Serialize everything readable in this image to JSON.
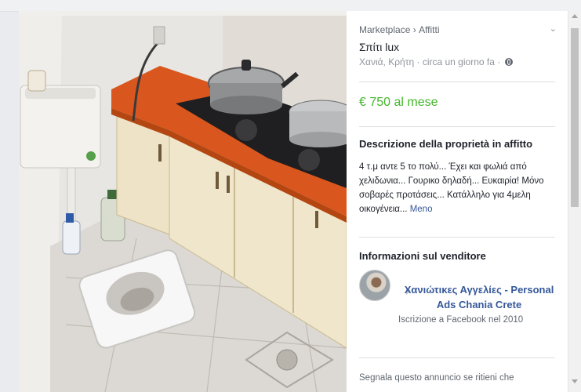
{
  "breadcrumb": {
    "marketplace": "Marketplace",
    "sep": "›",
    "category": "Affitti"
  },
  "listing": {
    "title": "Σπίτι lux",
    "location": "Χανιά, Κρήτη",
    "time": "circa un giorno fa",
    "price": "€ 750 al mese"
  },
  "description": {
    "heading": "Descrizione della proprietà in affitto",
    "text": "4 τ.μ αντε 5 το πολύ... Έχει και φωλιά από χελιδωνια... Γουρικο δηλαδή... Ευκαιρία! Μόνο σοβαρές προτάσεις... Κατάλληλο για 4μελη οικογένεια...",
    "more": "Meno"
  },
  "seller": {
    "heading": "Informazioni sul venditore",
    "name": "Χανιώτικες Αγγελίες - Personal Ads Chania Crete",
    "joined": "Iscrizione a Facebook nel 2010"
  },
  "report": {
    "text": "Segnala questo annuncio se ritieni che"
  },
  "icons": [
    "chevron-down-icon",
    "globe-icon",
    "arrow-right-icon"
  ],
  "colors": {
    "price": "#42b72a",
    "link": "#365899",
    "countertop": "#d9571e"
  }
}
